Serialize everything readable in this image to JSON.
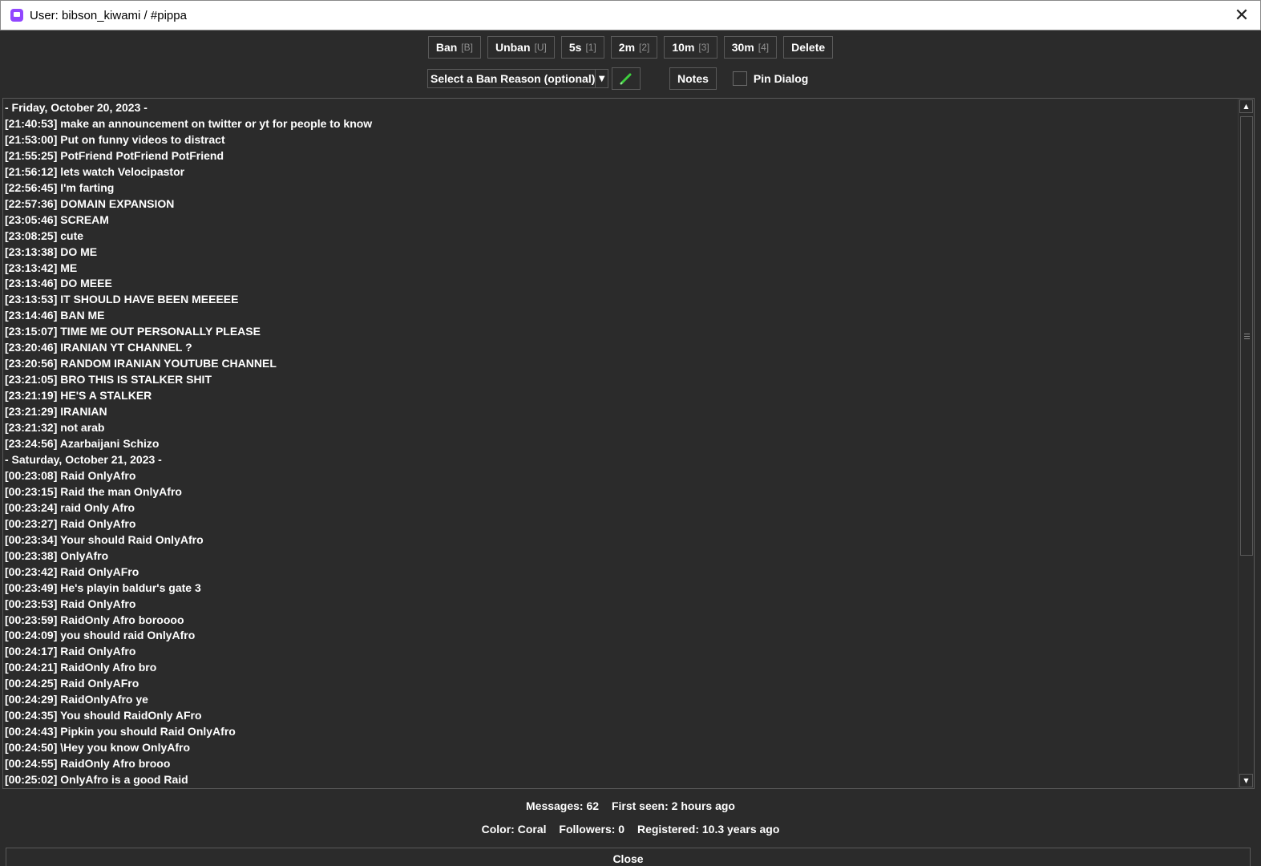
{
  "window": {
    "title": "User: bibson_kiwami / #pippa",
    "app_icon": "twitch-icon",
    "close_glyph": "✕"
  },
  "toolbar": {
    "buttons": [
      {
        "label": "Ban",
        "key": "[B]"
      },
      {
        "label": "Unban",
        "key": "[U]"
      },
      {
        "label": "5s",
        "key": "[1]"
      },
      {
        "label": "2m",
        "key": "[2]"
      },
      {
        "label": "10m",
        "key": "[3]"
      },
      {
        "label": "30m",
        "key": "[4]"
      },
      {
        "label": "Delete",
        "key": ""
      }
    ]
  },
  "options": {
    "ban_reason_select": "Select a Ban Reason (optional)",
    "notes_label": "Notes",
    "pin_dialog_label": "Pin Dialog",
    "pin_dialog_checked": false
  },
  "messages": [
    "- Friday, October 20, 2023 -",
    "[21:40:53] make an announcement on twitter or yt for people to know",
    "[21:53:00] Put on funny videos to distract",
    "[21:55:25] PotFriend PotFriend PotFriend",
    "[21:56:12] lets watch Velocipastor",
    "[22:56:45] I'm farting",
    "[22:57:36] DOMAIN EXPANSION",
    "[23:05:46] SCREAM",
    "[23:08:25] cute",
    "[23:13:38] DO ME",
    "[23:13:42] ME",
    "[23:13:46] DO MEEE",
    "[23:13:53] IT SHOULD HAVE BEEN MEEEEE",
    "[23:14:46] BAN ME",
    "[23:15:07] TIME ME OUT PERSONALLY PLEASE",
    "[23:20:46] IRANIAN YT CHANNEL ?",
    "[23:20:56] RANDOM IRANIAN YOUTUBE CHANNEL",
    "[23:21:05] BRO THIS IS STALKER SHIT",
    "[23:21:19] HE'S A STALKER",
    "[23:21:29] IRANIAN",
    "[23:21:32] not arab",
    "[23:24:56] Azarbaijani Schizo",
    "- Saturday, October 21, 2023 -",
    "[00:23:08] Raid OnlyAfro",
    "[00:23:15] Raid the man OnlyAfro",
    "[00:23:24] raid Only Afro",
    "[00:23:27] Raid OnlyAfro",
    "[00:23:34] Your should Raid OnlyAfro",
    "[00:23:38] OnlyAfro",
    "[00:23:42] Raid OnlyAFro",
    "[00:23:49] He's playin baldur's gate 3",
    "[00:23:53] Raid OnlyAfro",
    "[00:23:59] RaidOnly Afro boroooo",
    "[00:24:09] you should raid OnlyAfro",
    "[00:24:17] Raid OnlyAfro",
    "[00:24:21] RaidOnly Afro bro",
    "[00:24:25] Raid OnlyAFro",
    "[00:24:29] RaidOnlyAfro ye",
    "[00:24:35] You should RaidOnly AFro",
    "[00:24:43] Pipkin you should Raid OnlyAfro",
    "[00:24:50] \\Hey you know OnlyAfro",
    "[00:24:55] RaidOnly Afro brooo",
    "[00:25:02] OnlyAfro is a good Raid"
  ],
  "stats": {
    "messages": "Messages: 62",
    "first_seen": "First seen: 2 hours ago",
    "color": "Color: Coral",
    "followers": "Followers: 0",
    "registered": "Registered: 10.3 years ago"
  },
  "footer": {
    "close_label": "Close"
  },
  "colors": {
    "background": "#2b2b2b",
    "text": "#ffffff",
    "border": "#5a5a5a",
    "shortcut_key": "#8f8f8f",
    "pen_icon": "#3ecf3e",
    "twitch_purple": "#9146ff"
  }
}
